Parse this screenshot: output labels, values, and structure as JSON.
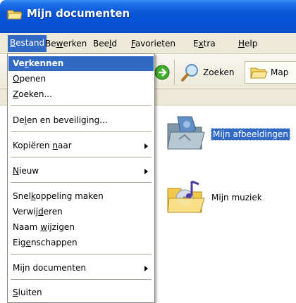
{
  "window": {
    "title": "Mijn documenten",
    "title_icon": "folder-icon"
  },
  "menubar": {
    "items": [
      {
        "pre": "",
        "u": "B",
        "post": "estand",
        "active": true
      },
      {
        "pre": "Be",
        "u": "w",
        "post": "erken",
        "active": false
      },
      {
        "pre": "Bee",
        "u": "l",
        "post": "d",
        "active": false
      },
      {
        "pre": "",
        "u": "F",
        "post": "avorieten",
        "active": false
      },
      {
        "pre": "E",
        "u": "x",
        "post": "tra",
        "active": false
      },
      {
        "pre": "",
        "u": "H",
        "post": "elp",
        "active": false
      }
    ]
  },
  "toolbar": {
    "search_label": "Zoeken",
    "folders_label": "Map",
    "icons": [
      "forward-icon",
      "search-icon",
      "folders-icon"
    ]
  },
  "files": [
    {
      "label": "Mijn afbeeldingen",
      "icon": "pictures-folder-icon",
      "selected": true
    },
    {
      "label": "Mijn muziek",
      "icon": "music-folder-icon",
      "selected": false
    }
  ],
  "file_menu": {
    "items": [
      {
        "pre": "Ve",
        "u": "r",
        "post": "kennen",
        "highlight": true,
        "submenu": false
      },
      {
        "pre": "",
        "u": "O",
        "post": "penen",
        "highlight": false,
        "submenu": false
      },
      {
        "pre": "",
        "u": "Z",
        "post": "oeken...",
        "highlight": false,
        "submenu": false
      },
      {
        "pre": "De",
        "u": "l",
        "post": "en en beveiliging...",
        "highlight": false,
        "submenu": false
      },
      {
        "pre": "Kopiëren ",
        "u": "n",
        "post": "aar",
        "highlight": false,
        "submenu": true
      },
      {
        "pre": "",
        "u": "N",
        "post": "ieuw",
        "highlight": false,
        "submenu": true
      },
      {
        "pre": "Snel",
        "u": "k",
        "post": "oppeling maken",
        "highlight": false,
        "submenu": false
      },
      {
        "pre": "Verwij",
        "u": "d",
        "post": "eren",
        "highlight": false,
        "submenu": false
      },
      {
        "pre": "Naam ",
        "u": "w",
        "post": "ijzigen",
        "highlight": false,
        "submenu": false
      },
      {
        "pre": "Eig",
        "u": "e",
        "post": "nschappen",
        "highlight": false,
        "submenu": false
      },
      {
        "pre": "Mijn documenten",
        "u": "",
        "post": "",
        "highlight": false,
        "submenu": true
      },
      {
        "pre": "",
        "u": "S",
        "post": "luiten",
        "highlight": false,
        "submenu": false
      }
    ]
  },
  "colors": {
    "title_blue": "#0a55d8",
    "menu_highlight": "#316ac5",
    "chrome": "#ece9d8"
  }
}
